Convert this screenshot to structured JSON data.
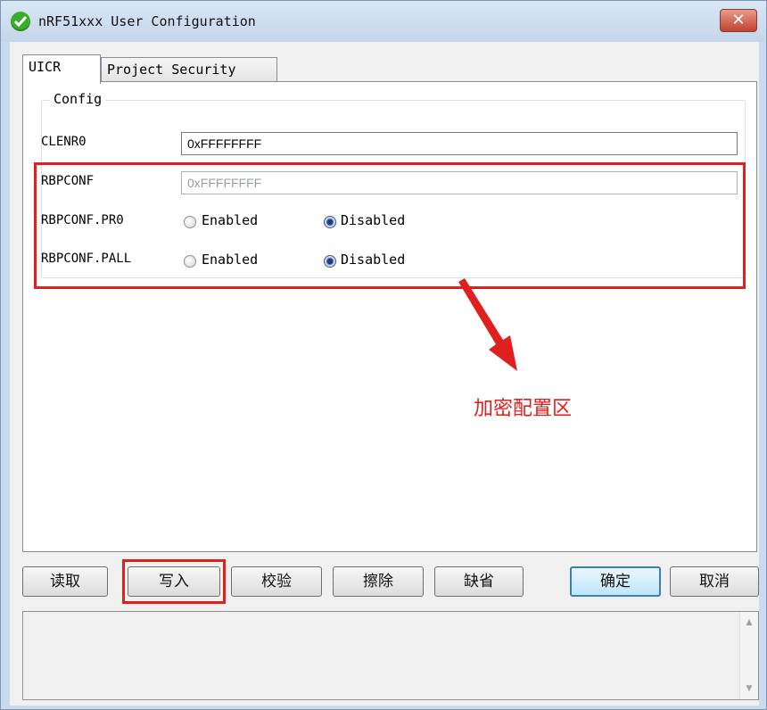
{
  "window": {
    "title": "nRF51xxx User Configuration",
    "close_glyph": "✕"
  },
  "tabs": [
    {
      "label": "UICR"
    },
    {
      "label": "Project Security"
    }
  ],
  "config": {
    "group_label": "Config",
    "clenr0": {
      "label": "CLENR0",
      "value": "0xFFFFFFFF"
    },
    "rbpconf": {
      "label": "RBPCONF",
      "value": "0xFFFFFFFF"
    },
    "rbpconf_pr0": {
      "label": "RBPCONF.PR0",
      "enabled_label": "Enabled",
      "disabled_label": "Disabled",
      "selected": "Disabled"
    },
    "rbpconf_pall": {
      "label": "RBPCONF.PALL",
      "enabled_label": "Enabled",
      "disabled_label": "Disabled",
      "selected": "Disabled"
    }
  },
  "annotation": {
    "text": "加密配置区",
    "color": "#e01f1f"
  },
  "buttons": {
    "read": "读取",
    "write": "写入",
    "verify": "校验",
    "erase": "擦除",
    "default": "缺省",
    "ok": "确定",
    "cancel": "取消"
  },
  "icons": {
    "app": "check-circle-icon",
    "scroll_up": "triangle-up-icon",
    "scroll_down": "triangle-down-icon"
  },
  "log": {
    "text": ""
  }
}
